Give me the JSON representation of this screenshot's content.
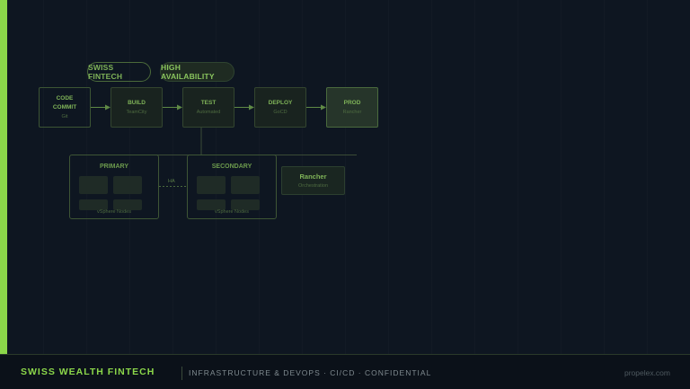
{
  "tags": [
    "SWISS FINTECH",
    "HIGH AVAILABILITY"
  ],
  "pipeline": [
    {
      "title_lines": [
        "CODE",
        "COMMIT"
      ],
      "sub": "Git"
    },
    {
      "title_lines": [
        "BUILD"
      ],
      "sub": "TeamCity"
    },
    {
      "title_lines": [
        "TEST"
      ],
      "sub": "Automated"
    },
    {
      "title_lines": [
        "DEPLOY"
      ],
      "sub": "GoCD"
    },
    {
      "title_lines": [
        "PROD"
      ],
      "sub": "Rancher"
    }
  ],
  "clusters": [
    {
      "title": "PRIMARY",
      "footer": "vSphere Nodes"
    },
    {
      "title": "SECONDARY",
      "footer": "vSphere Nodes"
    }
  ],
  "ha_label": "HA",
  "rancher": {
    "title": "Rancher",
    "sub": "Orchestration"
  },
  "footer": {
    "brand": "SWISS WEALTH FINTECH",
    "meta": "INFRASTRUCTURE & DEVOPS · CI/CD · CONFIDENTIAL",
    "url": "propelex.com"
  },
  "colors": {
    "accent": "#8bd64a",
    "background": "#0e1621"
  }
}
